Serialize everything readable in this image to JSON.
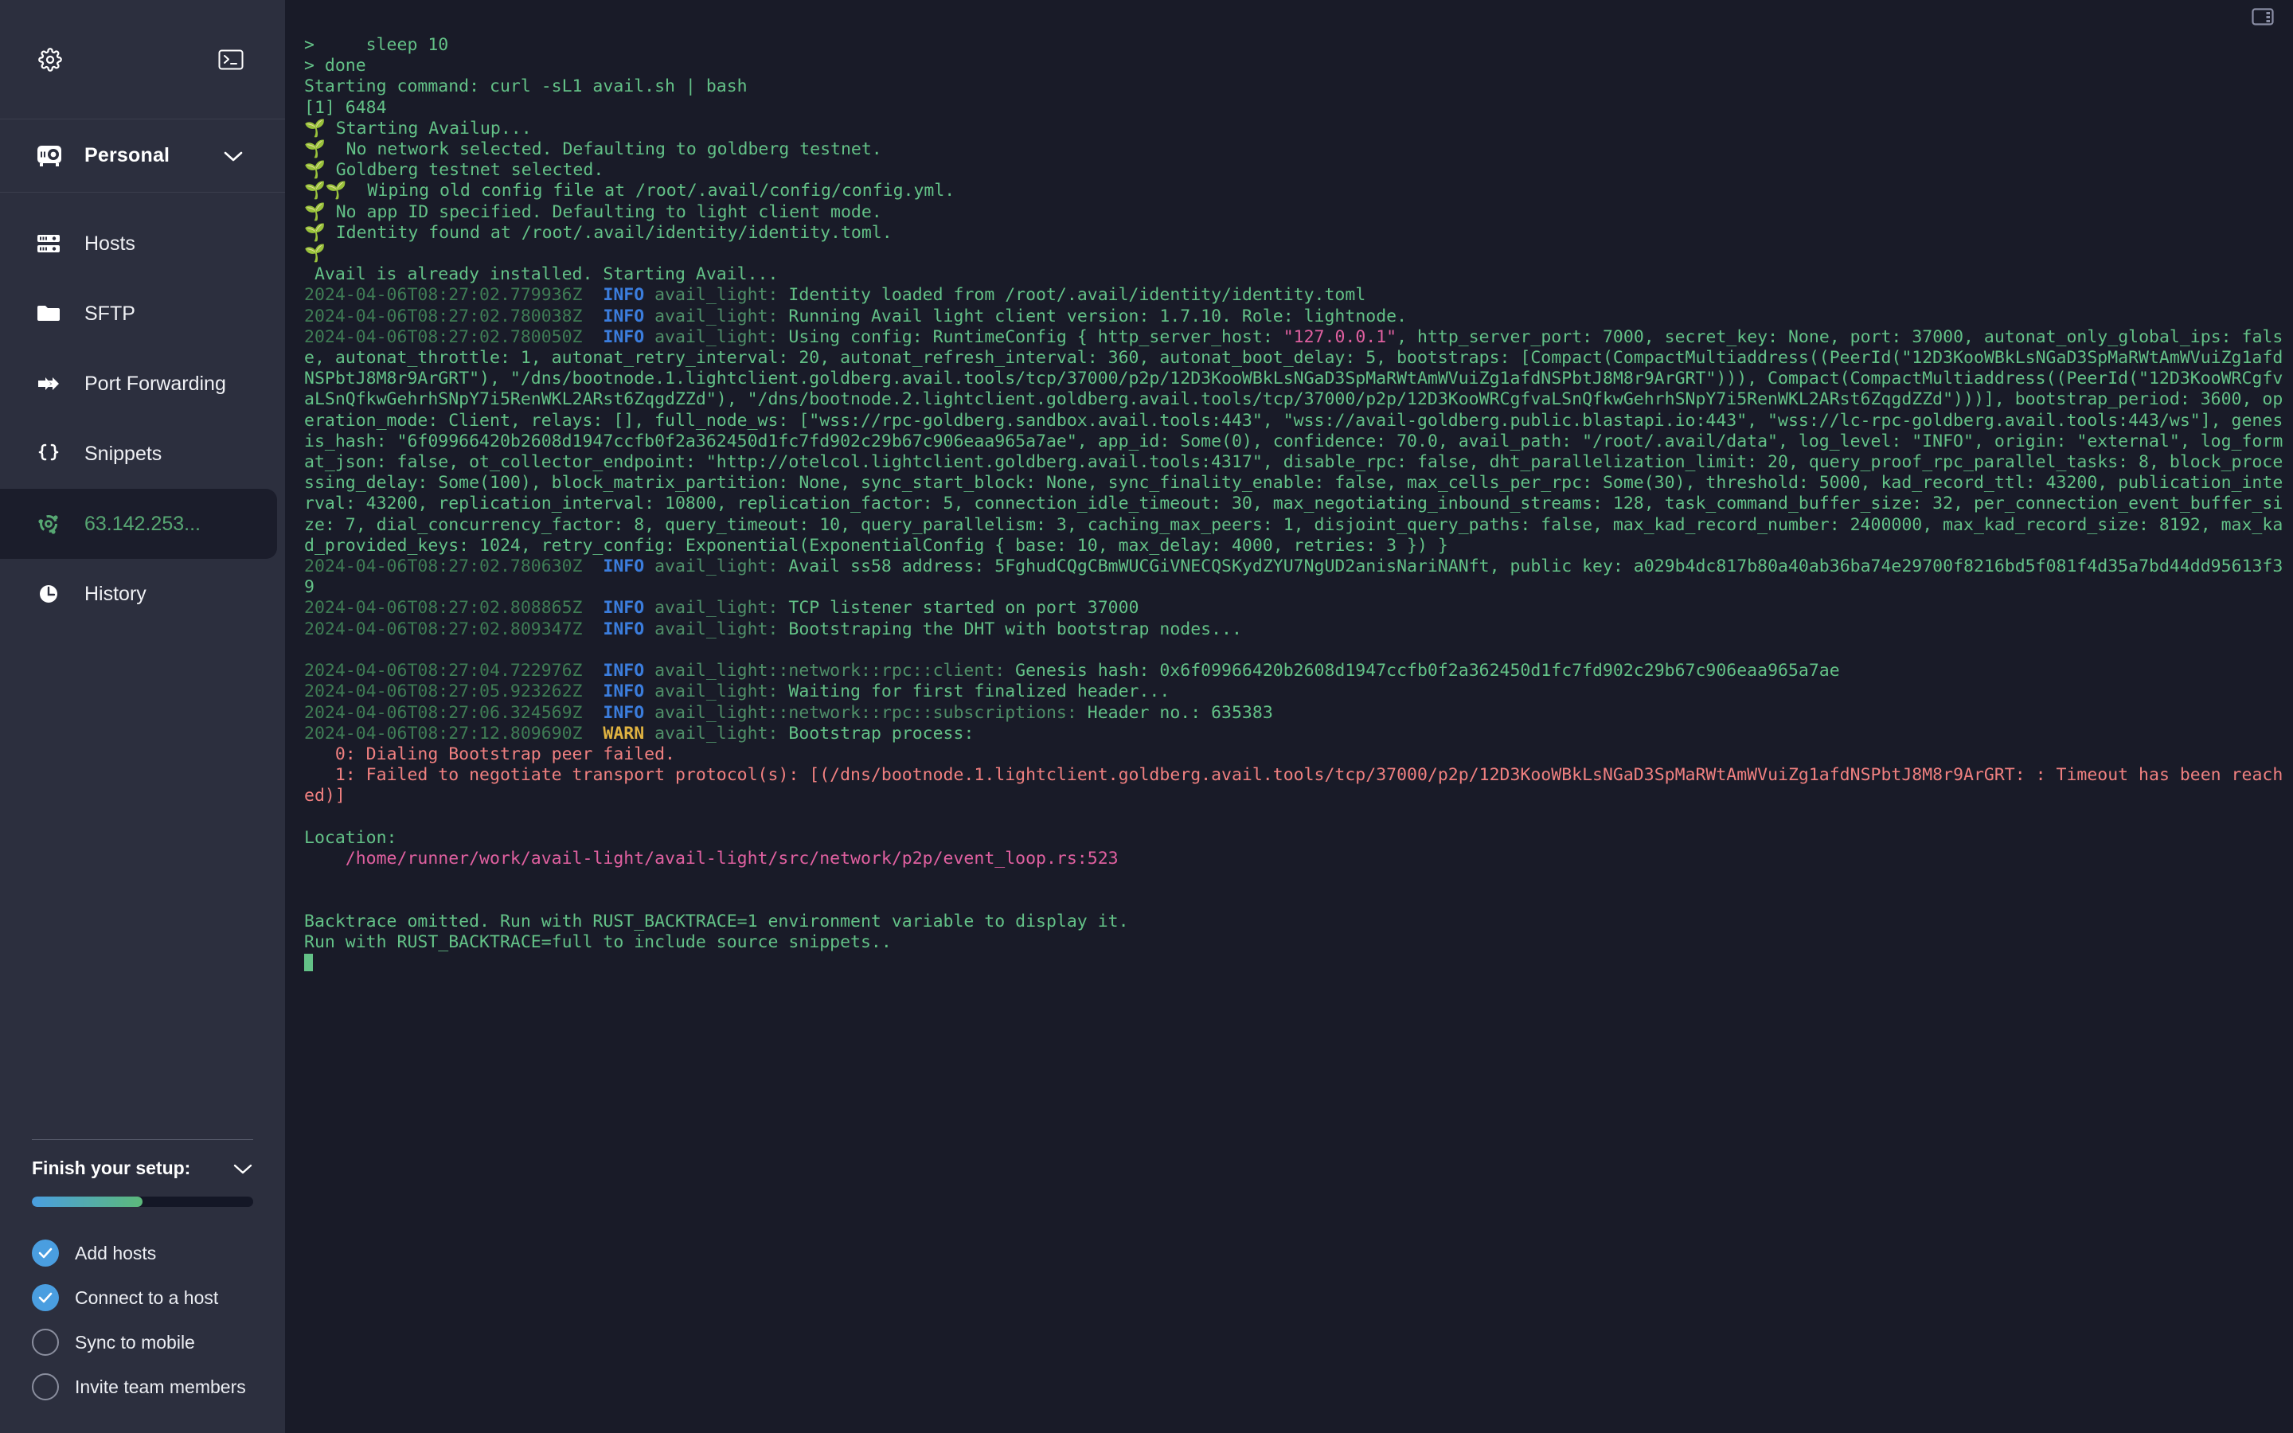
{
  "sidebar": {
    "top_icons": [
      {
        "name": "gear-icon",
        "label": "Settings"
      },
      {
        "name": "terminal-icon",
        "label": "New terminal"
      }
    ],
    "org": {
      "label": "Personal",
      "icon": "vault-icon",
      "chevron": "chevron-down-icon"
    },
    "items": [
      {
        "label": "Hosts",
        "icon": "server-icon",
        "active": false
      },
      {
        "label": "SFTP",
        "icon": "folder-icon",
        "active": false
      },
      {
        "label": "Port Forwarding",
        "icon": "forward-arrow-icon",
        "active": false
      },
      {
        "label": "Snippets",
        "icon": "braces-icon",
        "active": false
      },
      {
        "label": "63.142.253...",
        "icon": "ubuntu-icon",
        "active": true
      },
      {
        "label": "History",
        "icon": "clock-icon",
        "active": false
      }
    ],
    "setup": {
      "title": "Finish your setup:",
      "chevron": "chevron-down-icon",
      "progress_percent": 50,
      "tasks": [
        {
          "label": "Add hosts",
          "done": true
        },
        {
          "label": "Connect to a host",
          "done": true
        },
        {
          "label": "Sync to mobile",
          "done": false
        },
        {
          "label": "Invite team members",
          "done": false
        }
      ]
    }
  },
  "topbar": {
    "panel_icon": "layout-panel-icon"
  },
  "terminal": {
    "accent_green": "#63c187",
    "background": "#191b28",
    "lines": [
      {
        "segments": [
          {
            "c": "g",
            "t": ">     sleep 10"
          }
        ]
      },
      {
        "segments": [
          {
            "c": "g",
            "t": "> done"
          }
        ]
      },
      {
        "segments": [
          {
            "c": "g",
            "t": "Starting command: curl -sL1 avail.sh | bash"
          }
        ]
      },
      {
        "segments": [
          {
            "c": "g",
            "t": "[1] 6484"
          }
        ]
      },
      {
        "segments": [
          {
            "c": "g",
            "t": "🌱 Starting Availup..."
          }
        ]
      },
      {
        "segments": [
          {
            "c": "g",
            "t": "🌱  No network selected. Defaulting to goldberg testnet."
          }
        ]
      },
      {
        "segments": [
          {
            "c": "g",
            "t": "🌱 Goldberg testnet selected."
          }
        ]
      },
      {
        "segments": [
          {
            "c": "g",
            "t": "🌱🌱  Wiping old config file at /root/.avail/config/config.yml."
          }
        ]
      },
      {
        "segments": [
          {
            "c": "g",
            "t": "🌱 No app ID specified. Defaulting to light client mode."
          }
        ]
      },
      {
        "segments": [
          {
            "c": "g",
            "t": "🌱 Identity found at /root/.avail/identity/identity.toml."
          }
        ]
      },
      {
        "segments": [
          {
            "c": "g",
            "t": "🌱"
          }
        ]
      },
      {
        "segments": [
          {
            "c": "g",
            "t": " Avail is already installed. Starting Avail..."
          }
        ]
      },
      {
        "segments": [
          {
            "c": "ts",
            "t": "2024-04-06T08:27:02.779936Z"
          },
          {
            "c": "info",
            "t": "  INFO "
          },
          {
            "c": "mod",
            "t": "avail_light: "
          },
          {
            "c": "g",
            "t": "Identity loaded from /root/.avail/identity/identity.toml"
          }
        ]
      },
      {
        "segments": [
          {
            "c": "ts",
            "t": "2024-04-06T08:27:02.780038Z"
          },
          {
            "c": "info",
            "t": "  INFO "
          },
          {
            "c": "mod",
            "t": "avail_light: "
          },
          {
            "c": "g",
            "t": "Running Avail light client version: 1.7.10. Role: lightnode."
          }
        ]
      },
      {
        "segments": [
          {
            "c": "ts",
            "t": "2024-04-06T08:27:02.780050Z"
          },
          {
            "c": "info",
            "t": "  INFO "
          },
          {
            "c": "mod",
            "t": "avail_light: "
          },
          {
            "c": "g",
            "t": "Using config: RuntimeConfig { http_server_host: "
          },
          {
            "c": "pink",
            "t": "\"127.0.0.1\""
          },
          {
            "c": "g",
            "t": ", http_server_port: 7000, secret_key: None, port: 37000, autonat_only_global_ips: false, autonat_throttle: 1, autonat_retry_interval: 20, autonat_refresh_interval: 360, autonat_boot_delay: 5, bootstraps: [Compact(CompactMultiaddress((PeerId(\"12D3KooWBkLsNGaD3SpMaRWtAmWVuiZg1afdNSPbtJ8M8r9ArGRT\"), \"/dns/bootnode.1.lightclient.goldberg.avail.tools/tcp/37000/p2p/12D3KooWBkLsNGaD3SpMaRWtAmWVuiZg1afdNSPbtJ8M8r9ArGRT\"))), Compact(CompactMultiaddress((PeerId(\"12D3KooWRCgfvaLSnQfkwGehrhSNpY7i5RenWKL2ARst6ZqgdZZd\"), \"/dns/bootnode.2.lightclient.goldberg.avail.tools/tcp/37000/p2p/12D3KooWRCgfvaLSnQfkwGehrhSNpY7i5RenWKL2ARst6ZqgdZZd\")))], bootstrap_period: 3600, operation_mode: Client, relays: [], full_node_ws: [\"wss://rpc-goldberg.sandbox.avail.tools:443\", \"wss://avail-goldberg.public.blastapi.io:443\", \"wss://lc-rpc-goldberg.avail.tools:443/ws\"], genesis_hash: \"6f09966420b2608d1947ccfb0f2a362450d1fc7fd902c29b67c906eaa965a7ae\", app_id: Some(0), confidence: 70.0, avail_path: \"/root/.avail/data\", log_level: \"INFO\", origin: \"external\", log_format_json: false, ot_collector_endpoint: \"http://otelcol.lightclient.goldberg.avail.tools:4317\", disable_rpc: false, dht_parallelization_limit: 20, query_proof_rpc_parallel_tasks: 8, block_processing_delay: Some(100), block_matrix_partition: None, sync_start_block: None, sync_finality_enable: false, max_cells_per_rpc: Some(30), threshold: 5000, kad_record_ttl: 43200, publication_interval: 43200, replication_interval: 10800, replication_factor: 5, connection_idle_timeout: 30, max_negotiating_inbound_streams: 128, task_command_buffer_size: 32, per_connection_event_buffer_size: 7, dial_concurrency_factor: 8, query_timeout: 10, query_parallelism: 3, caching_max_peers: 1, disjoint_query_paths: false, max_kad_record_number: 2400000, max_kad_record_size: 8192, max_kad_provided_keys: 1024, retry_config: Exponential(ExponentialConfig { base: 10, max_delay: 4000, retries: 3 }) }"
          }
        ]
      },
      {
        "segments": [
          {
            "c": "ts",
            "t": "2024-04-06T08:27:02.780630Z"
          },
          {
            "c": "info",
            "t": "  INFO "
          },
          {
            "c": "mod",
            "t": "avail_light: "
          },
          {
            "c": "g",
            "t": "Avail ss58 address: 5FghudCQgCBmWUCGiVNECQSKydZYU7NgUD2anisNariNANft, public key: a029b4dc817b80a40ab36ba74e29700f8216bd5f081f4d35a7bd44dd95613f39"
          }
        ]
      },
      {
        "segments": [
          {
            "c": "ts",
            "t": "2024-04-06T08:27:02.808865Z"
          },
          {
            "c": "info",
            "t": "  INFO "
          },
          {
            "c": "mod",
            "t": "avail_light: "
          },
          {
            "c": "g",
            "t": "TCP listener started on port 37000"
          }
        ]
      },
      {
        "segments": [
          {
            "c": "ts",
            "t": "2024-04-06T08:27:02.809347Z"
          },
          {
            "c": "info",
            "t": "  INFO "
          },
          {
            "c": "mod",
            "t": "avail_light: "
          },
          {
            "c": "g",
            "t": "Bootstraping the DHT with bootstrap nodes..."
          }
        ]
      },
      {
        "segments": [
          {
            "c": "g",
            "t": ""
          }
        ]
      },
      {
        "segments": [
          {
            "c": "ts",
            "t": "2024-04-06T08:27:04.722976Z"
          },
          {
            "c": "info",
            "t": "  INFO "
          },
          {
            "c": "mod",
            "t": "avail_light::network::rpc::client: "
          },
          {
            "c": "g",
            "t": "Genesis hash: 0x6f09966420b2608d1947ccfb0f2a362450d1fc7fd902c29b67c906eaa965a7ae"
          }
        ]
      },
      {
        "segments": [
          {
            "c": "ts",
            "t": "2024-04-06T08:27:05.923262Z"
          },
          {
            "c": "info",
            "t": "  INFO "
          },
          {
            "c": "mod",
            "t": "avail_light: "
          },
          {
            "c": "g",
            "t": "Waiting for first finalized header..."
          }
        ]
      },
      {
        "segments": [
          {
            "c": "ts",
            "t": "2024-04-06T08:27:06.324569Z"
          },
          {
            "c": "info",
            "t": "  INFO "
          },
          {
            "c": "mod",
            "t": "avail_light::network::rpc::subscriptions: "
          },
          {
            "c": "g",
            "t": "Header no.: 635383"
          }
        ]
      },
      {
        "segments": [
          {
            "c": "ts",
            "t": "2024-04-06T08:27:12.809690Z"
          },
          {
            "c": "warn",
            "t": "  WARN "
          },
          {
            "c": "mod",
            "t": "avail_light: "
          },
          {
            "c": "g",
            "t": "Bootstrap process:"
          }
        ]
      },
      {
        "segments": [
          {
            "c": "err",
            "t": "   0: Dialing Bootstrap peer failed."
          }
        ]
      },
      {
        "segments": [
          {
            "c": "err",
            "t": "   1: Failed to negotiate transport protocol(s): [(/dns/bootnode.1.lightclient.goldberg.avail.tools/tcp/37000/p2p/12D3KooWBkLsNGaD3SpMaRWtAmWVuiZg1afdNSPbtJ8M8r9ArGRT: : Timeout has been reached)]"
          }
        ]
      },
      {
        "segments": [
          {
            "c": "g",
            "t": ""
          }
        ]
      },
      {
        "segments": [
          {
            "c": "g",
            "t": "Location:"
          }
        ]
      },
      {
        "segments": [
          {
            "c": "pink",
            "t": "    /home/runner/work/avail-light/avail-light/src/network/p2p/event_loop.rs:523"
          }
        ]
      },
      {
        "segments": [
          {
            "c": "g",
            "t": ""
          }
        ]
      },
      {
        "segments": [
          {
            "c": "g",
            "t": ""
          }
        ]
      },
      {
        "segments": [
          {
            "c": "g",
            "t": "Backtrace omitted. Run with RUST_BACKTRACE=1 environment variable to display it."
          }
        ]
      },
      {
        "segments": [
          {
            "c": "g",
            "t": "Run with RUST_BACKTRACE=full to include source snippets.."
          }
        ]
      }
    ]
  }
}
